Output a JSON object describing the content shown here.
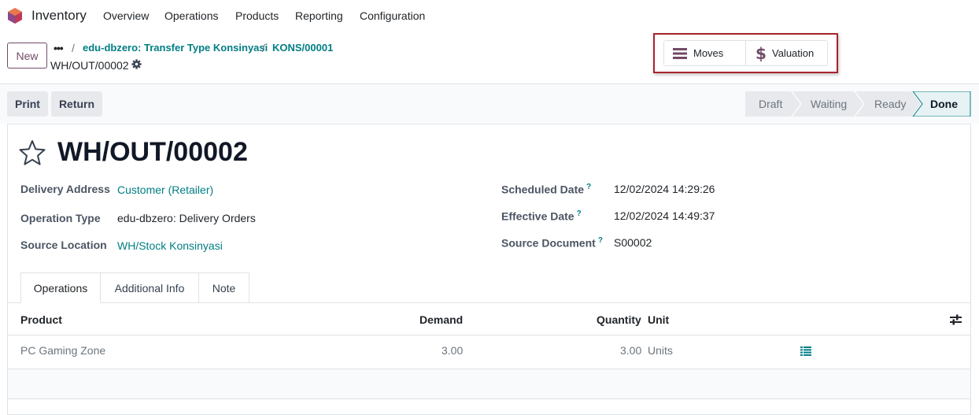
{
  "app": {
    "name": "Inventory",
    "menu": [
      "Overview",
      "Operations",
      "Products",
      "Reporting",
      "Configuration"
    ]
  },
  "control": {
    "new_label": "New",
    "breadcrumb": [
      "edu-dbzero: Transfer Type Konsinyasi",
      "KONS/00001"
    ],
    "current": "WH/OUT/00002"
  },
  "smart_buttons": {
    "moves": "Moves",
    "valuation": "Valuation"
  },
  "actions": {
    "print": "Print",
    "return": "Return"
  },
  "statuses": [
    "Draft",
    "Waiting",
    "Ready",
    "Done"
  ],
  "active_status": "Done",
  "record": {
    "title": "WH/OUT/00002",
    "delivery_address_label": "Delivery Address",
    "delivery_address": "Customer (Retailer)",
    "operation_type_label": "Operation Type",
    "operation_type": "edu-dbzero: Delivery Orders",
    "source_location_label": "Source Location",
    "source_location": "WH/Stock Konsinyasi",
    "scheduled_date_label": "Scheduled Date",
    "scheduled_date": "12/02/2024 14:29:26",
    "effective_date_label": "Effective Date",
    "effective_date": "12/02/2024 14:49:37",
    "source_document_label": "Source Document",
    "source_document": "S00002",
    "help_mark": "?"
  },
  "tabs": [
    "Operations",
    "Additional Info",
    "Note"
  ],
  "table": {
    "headers": {
      "product": "Product",
      "demand": "Demand",
      "quantity": "Quantity",
      "unit": "Unit"
    },
    "rows": [
      {
        "product": "PC Gaming Zone",
        "demand": "3.00",
        "quantity": "3.00",
        "unit": "Units"
      }
    ]
  },
  "colors": {
    "brand": "#714b67",
    "link": "#017e84",
    "highlight": "#a8232d"
  },
  "icons": [
    "app-logo-icon",
    "gear-icon",
    "list-icon",
    "dollar-icon",
    "star-icon",
    "settings-sliders-icon",
    "detail-list-icon"
  ]
}
